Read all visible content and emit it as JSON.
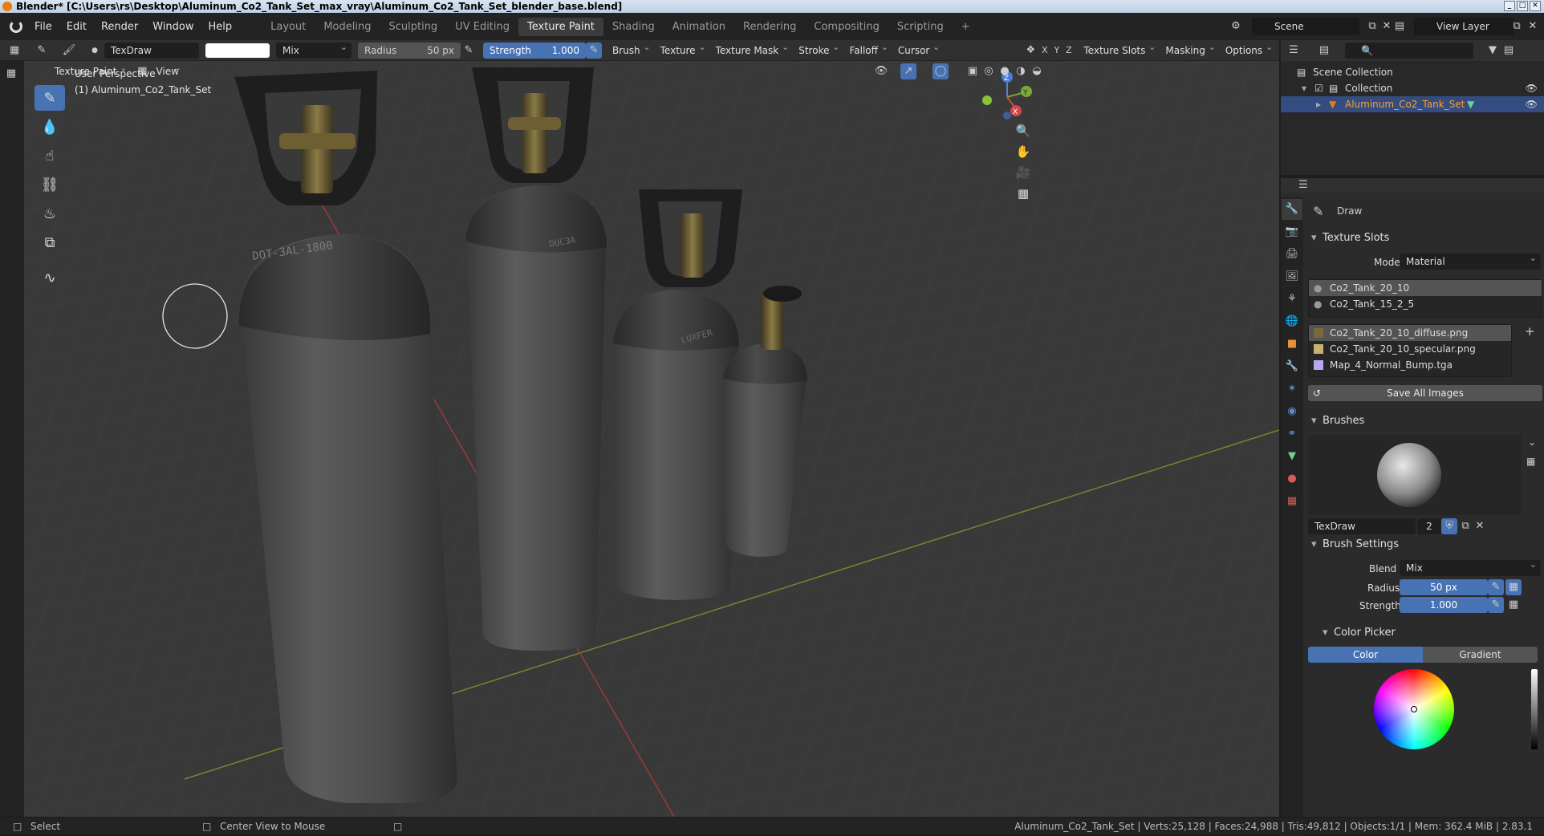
{
  "window": {
    "title": "Blender* [C:\\Users\\rs\\Desktop\\Aluminum_Co2_Tank_Set_max_vray\\Aluminum_Co2_Tank_Set_blender_base.blend]"
  },
  "menus": [
    "File",
    "Edit",
    "Render",
    "Window",
    "Help"
  ],
  "workspaces": [
    "Layout",
    "Modeling",
    "Sculpting",
    "UV Editing",
    "Texture Paint",
    "Shading",
    "Animation",
    "Rendering",
    "Compositing",
    "Scripting"
  ],
  "active_workspace": "Texture Paint",
  "scene": {
    "name": "Scene",
    "view_layer": "View Layer"
  },
  "tool_header": {
    "brush_name": "TexDraw",
    "blend": "Mix",
    "radius_label": "Radius",
    "radius_value": "50 px",
    "strength_label": "Strength",
    "strength_value": "1.000",
    "menus": [
      "Brush",
      "Texture",
      "Texture Mask",
      "Stroke",
      "Falloff",
      "Cursor"
    ],
    "axes": [
      "X",
      "Y",
      "Z"
    ],
    "right_menus": [
      "Texture Slots",
      "Masking",
      "Options"
    ]
  },
  "viewport_header": {
    "mode": "Texture Paint",
    "view_menu": "View"
  },
  "viewport": {
    "perspective": "User Perspective",
    "object": "(1) Aluminum_Co2_Tank_Set"
  },
  "tank_labels": [
    "DOT-3AL-1800",
    "DUC3A",
    "LUXFER"
  ],
  "gizmo": {
    "x": "X",
    "y": "Y",
    "z": "Z"
  },
  "outliner": {
    "root": "Scene Collection",
    "collection": "Collection",
    "object": "Aluminum_Co2_Tank_Set"
  },
  "properties": {
    "tool_name": "Draw",
    "texture_slots": {
      "title": "Texture Slots",
      "mode_label": "Mode",
      "mode_value": "Material",
      "materials": [
        "Co2_Tank_20_10",
        "Co2_Tank_15_2_5"
      ],
      "images": [
        "Co2_Tank_20_10_diffuse.png",
        "Co2_Tank_20_10_specular.png",
        "Map_4_Normal_Bump.tga"
      ],
      "save_button": "Save All Images"
    },
    "brushes": {
      "title": "Brushes",
      "name": "TexDraw",
      "users": "2"
    },
    "brush_settings": {
      "title": "Brush Settings",
      "blend_label": "Blend",
      "blend_value": "Mix",
      "radius_label": "Radius",
      "radius_value": "50 px",
      "strength_label": "Strength",
      "strength_value": "1.000"
    },
    "color_picker": {
      "title": "Color Picker",
      "tab_color": "Color",
      "tab_gradient": "Gradient"
    }
  },
  "statusbar": {
    "select": "Select",
    "center": "Center View to Mouse",
    "stats": "Aluminum_Co2_Tank_Set | Verts:25,128 | Faces:24,988 | Tris:49,812 | Objects:1/1 | Mem: 362.4 MiB | 2.83.1"
  },
  "colors": {
    "accent": "#4772b3",
    "selected": "#334d80",
    "header": "#303030",
    "orange": "#e87d0d"
  }
}
